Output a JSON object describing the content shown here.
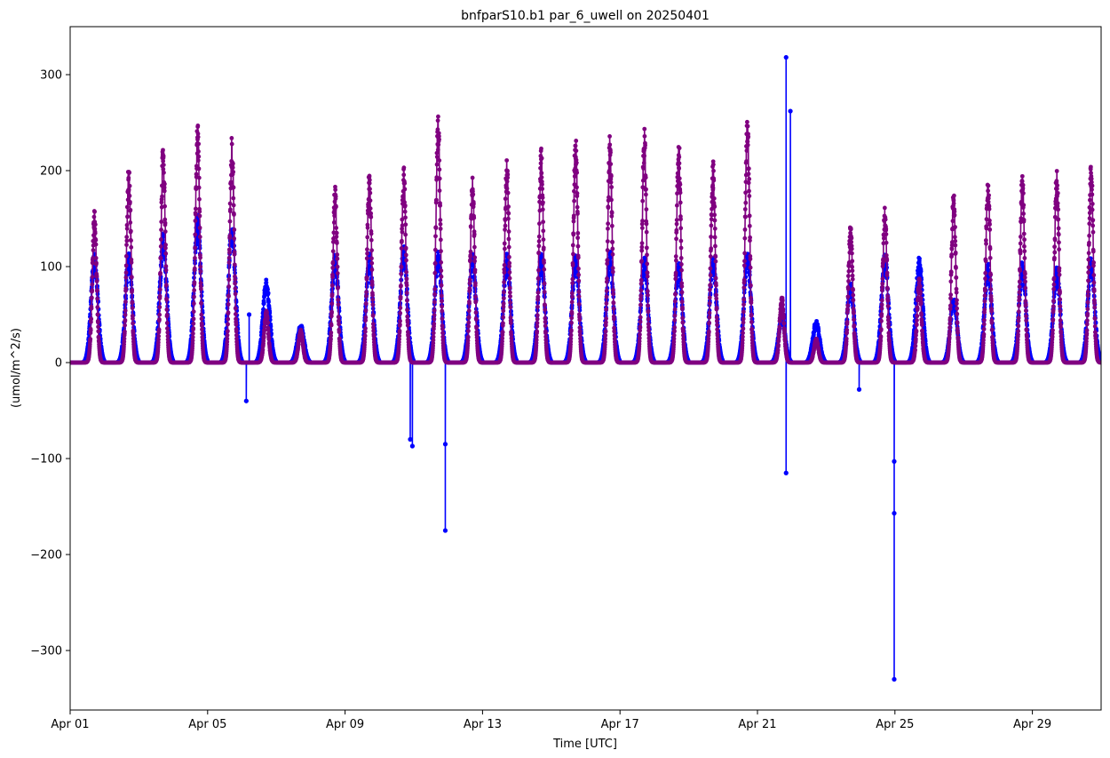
{
  "chart_data": {
    "type": "line",
    "title": "bnfparS10.b1 par_6_uwell on 20250401",
    "xlabel": "Time [UTC]",
    "ylabel": "(umol/m^2/s)",
    "xlim": [
      "2025-04-01",
      "2025-05-01"
    ],
    "ylim": [
      -362,
      350
    ],
    "x_ticks": [
      {
        "date": "2025-04-01",
        "label": "Apr 01"
      },
      {
        "date": "2025-04-05",
        "label": "Apr 05"
      },
      {
        "date": "2025-04-09",
        "label": "Apr 09"
      },
      {
        "date": "2025-04-13",
        "label": "Apr 13"
      },
      {
        "date": "2025-04-17",
        "label": "Apr 17"
      },
      {
        "date": "2025-04-21",
        "label": "Apr 21"
      },
      {
        "date": "2025-04-25",
        "label": "Apr 25"
      },
      {
        "date": "2025-04-29",
        "label": "Apr 29"
      }
    ],
    "y_ticks": [
      -300,
      -200,
      -100,
      0,
      100,
      200,
      300
    ],
    "grid": false,
    "series": [
      {
        "color": "#0000ff",
        "marker": "circle",
        "daily_peaks": [
          {
            "date": "2025-04-01",
            "peak": 115
          },
          {
            "date": "2025-04-02",
            "peak": 115
          },
          {
            "date": "2025-04-03",
            "peak": 135
          },
          {
            "date": "2025-04-04",
            "peak": 155
          },
          {
            "date": "2025-04-05",
            "peak": 150
          },
          {
            "date": "2025-04-06",
            "peak": 88
          },
          {
            "date": "2025-04-07",
            "peak": 40
          },
          {
            "date": "2025-04-08",
            "peak": 114
          },
          {
            "date": "2025-04-09",
            "peak": 115
          },
          {
            "date": "2025-04-10",
            "peak": 122
          },
          {
            "date": "2025-04-11",
            "peak": 118
          },
          {
            "date": "2025-04-12",
            "peak": 114
          },
          {
            "date": "2025-04-13",
            "peak": 115
          },
          {
            "date": "2025-04-14",
            "peak": 115
          },
          {
            "date": "2025-04-15",
            "peak": 115
          },
          {
            "date": "2025-04-16",
            "peak": 117
          },
          {
            "date": "2025-04-17",
            "peak": 110
          },
          {
            "date": "2025-04-18",
            "peak": 105
          },
          {
            "date": "2025-04-19",
            "peak": 110
          },
          {
            "date": "2025-04-20",
            "peak": 118
          },
          {
            "date": "2025-04-21",
            "peak": 48
          },
          {
            "date": "2025-04-22",
            "peak": 44
          },
          {
            "date": "2025-04-23",
            "peak": 84
          },
          {
            "date": "2025-04-24",
            "peak": 115
          },
          {
            "date": "2025-04-25",
            "peak": 110
          },
          {
            "date": "2025-04-26",
            "peak": 68
          },
          {
            "date": "2025-04-27",
            "peak": 105
          },
          {
            "date": "2025-04-28",
            "peak": 105
          },
          {
            "date": "2025-04-29",
            "peak": 100
          },
          {
            "date": "2025-04-30",
            "peak": 110
          }
        ],
        "outliers": [
          {
            "x": "2025-04-06T03:00",
            "y": -40
          },
          {
            "x": "2025-04-06T05:00",
            "y": 50
          },
          {
            "x": "2025-04-10T21:30",
            "y": -80
          },
          {
            "x": "2025-04-10T23:00",
            "y": -87
          },
          {
            "x": "2025-04-11T22:00",
            "y": -175
          },
          {
            "x": "2025-04-11T22:00",
            "y": -85
          },
          {
            "x": "2025-04-21T20:00",
            "y": 318
          },
          {
            "x": "2025-04-21T20:00",
            "y": -115
          },
          {
            "x": "2025-04-21T23:00",
            "y": 262
          },
          {
            "x": "2025-04-23T23:00",
            "y": -28
          },
          {
            "x": "2025-04-24T23:30",
            "y": -330
          },
          {
            "x": "2025-04-24T23:30",
            "y": -157
          },
          {
            "x": "2025-04-24T23:30",
            "y": -103
          }
        ]
      },
      {
        "color": "#800080",
        "marker": "circle",
        "daily_peaks": [
          {
            "date": "2025-04-01",
            "peak": 160
          },
          {
            "date": "2025-04-02",
            "peak": 210
          },
          {
            "date": "2025-04-03",
            "peak": 232
          },
          {
            "date": "2025-04-04",
            "peak": 255
          },
          {
            "date": "2025-04-05",
            "peak": 240
          },
          {
            "date": "2025-04-06",
            "peak": 55
          },
          {
            "date": "2025-04-07",
            "peak": 35
          },
          {
            "date": "2025-04-08",
            "peak": 185
          },
          {
            "date": "2025-04-09",
            "peak": 204
          },
          {
            "date": "2025-04-10",
            "peak": 205
          },
          {
            "date": "2025-04-11",
            "peak": 259
          },
          {
            "date": "2025-04-12",
            "peak": 193
          },
          {
            "date": "2025-04-13",
            "peak": 213
          },
          {
            "date": "2025-04-14",
            "peak": 227
          },
          {
            "date": "2025-04-15",
            "peak": 241
          },
          {
            "date": "2025-04-16",
            "peak": 239
          },
          {
            "date": "2025-04-17",
            "peak": 246
          },
          {
            "date": "2025-04-18",
            "peak": 239
          },
          {
            "date": "2025-04-19",
            "peak": 210
          },
          {
            "date": "2025-04-20",
            "peak": 259
          },
          {
            "date": "2025-04-21",
            "peak": 70
          },
          {
            "date": "2025-04-22",
            "peak": 26
          },
          {
            "date": "2025-04-23",
            "peak": 145
          },
          {
            "date": "2025-04-24",
            "peak": 162
          },
          {
            "date": "2025-04-25",
            "peak": 88
          },
          {
            "date": "2025-04-26",
            "peak": 180
          },
          {
            "date": "2025-04-27",
            "peak": 197
          },
          {
            "date": "2025-04-28",
            "peak": 200
          },
          {
            "date": "2025-04-29",
            "peak": 202
          },
          {
            "date": "2025-04-30",
            "peak": 212
          }
        ]
      }
    ]
  }
}
